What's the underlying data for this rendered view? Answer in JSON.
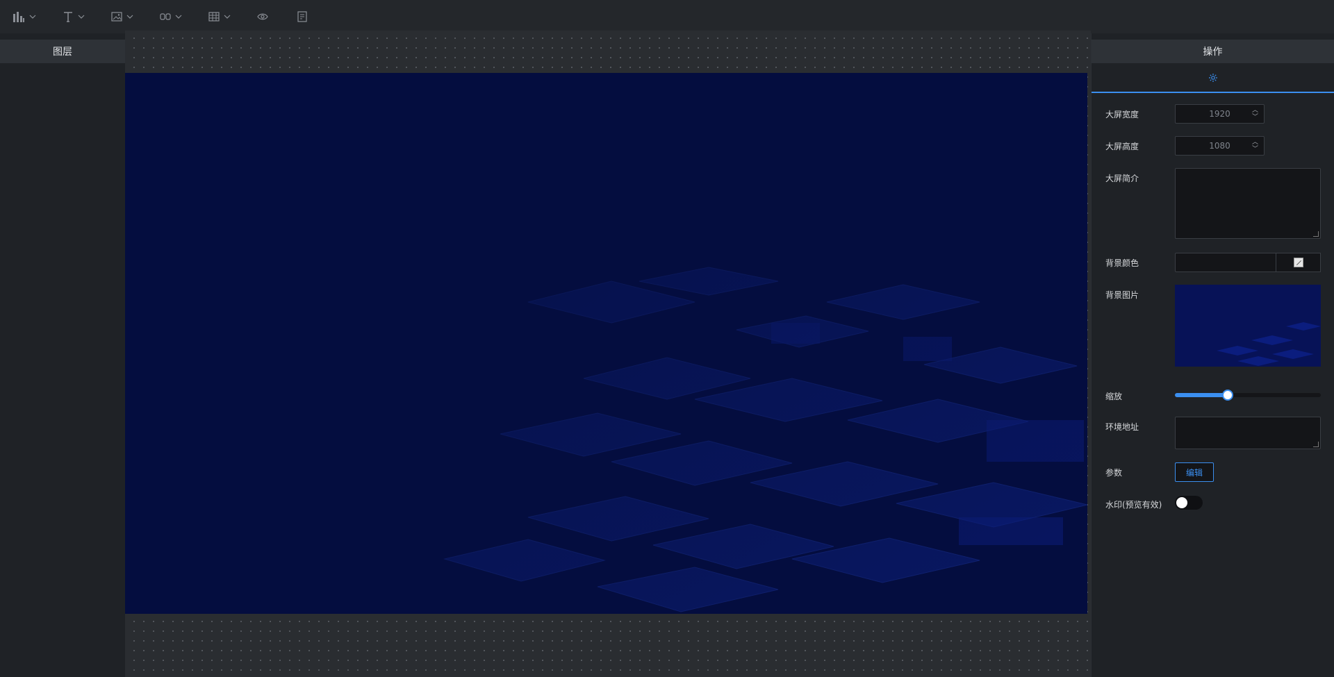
{
  "toolbar": {
    "tools": [
      {
        "icon": "bar-chart-icon"
      },
      {
        "icon": "text-icon"
      },
      {
        "icon": "image-icon"
      },
      {
        "icon": "component-icon"
      },
      {
        "icon": "table-icon"
      },
      {
        "icon": "eye-icon"
      },
      {
        "icon": "document-icon"
      }
    ]
  },
  "left_panel": {
    "title": "图层"
  },
  "right_panel": {
    "title": "操作",
    "tab_icon": "gear-icon",
    "fields": {
      "width_label": "大屏宽度",
      "width_value": "1920",
      "height_label": "大屏高度",
      "height_value": "1080",
      "intro_label": "大屏简介",
      "bg_color_label": "背景颜色",
      "bg_image_label": "背景图片",
      "scale_label": "缩放",
      "scale_fraction": 0.36,
      "env_label": "环境地址",
      "params_label": "参数",
      "edit_button": "编辑",
      "watermark_label": "水印(预览有效)",
      "watermark_on": false
    }
  },
  "colors": {
    "accent": "#3b8ff0",
    "screen_bg": "#040d3f",
    "panel_bg": "#1f2226"
  }
}
